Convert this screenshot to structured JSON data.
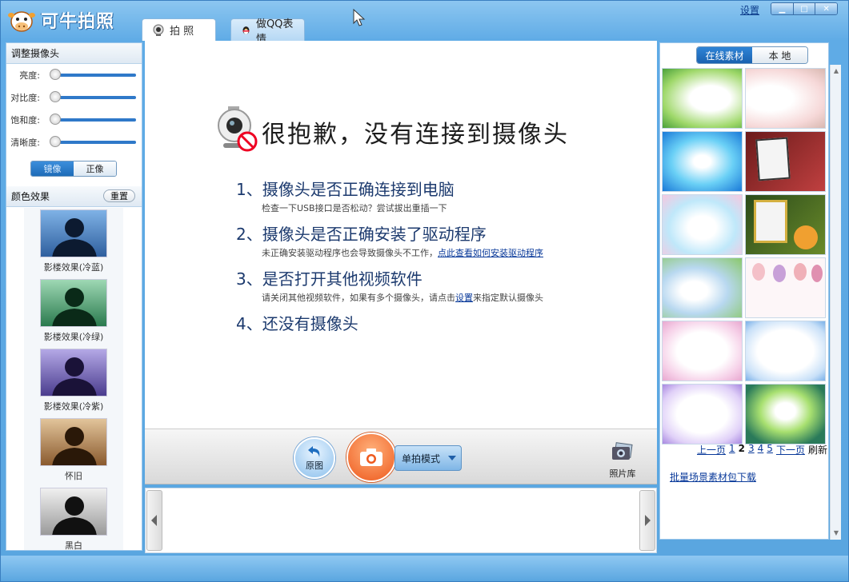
{
  "app": {
    "title": "可牛拍照",
    "settings_link": "设置"
  },
  "window_controls": {
    "minimize": "▁",
    "maximize": "□",
    "close": "✕"
  },
  "tabs": [
    {
      "label": "拍 照",
      "icon": "webcam-icon"
    },
    {
      "label": "做QQ表情",
      "icon": "qq-penguin-icon"
    }
  ],
  "left_panel": {
    "camera_section_title": "调整摄像头",
    "sliders": [
      {
        "label": "亮度:",
        "value": 0
      },
      {
        "label": "对比度:",
        "value": 0
      },
      {
        "label": "饱和度:",
        "value": 0
      },
      {
        "label": "清晰度:",
        "value": 0
      }
    ],
    "mirror_options": [
      "镜像",
      "正像"
    ],
    "mirror_selected": "镜像",
    "effects_section_title": "颜色效果",
    "reset_label": "重置",
    "effects": [
      {
        "label": "影楼效果(冷蓝)",
        "color": "#4a7fc0"
      },
      {
        "label": "影楼效果(冷绿)",
        "color": "#3c9a68"
      },
      {
        "label": "影楼效果(冷紫)",
        "color": "#6a5aa8"
      },
      {
        "label": "怀旧",
        "color": "#a87a4a"
      },
      {
        "label": "黑白",
        "color": "#8a8a8a"
      }
    ]
  },
  "center": {
    "headline": "很抱歉，没有连接到摄像头",
    "items": [
      {
        "title": "1、摄像头是否正确连接到电脑",
        "sub": "检查一下USB接口是否松动？尝试拔出重插一下",
        "link": "",
        "sub_after": ""
      },
      {
        "title": "2、摄像头是否正确安装了驱动程序",
        "sub": "未正确安装驱动程序也会导致摄像头不工作，",
        "link": "点此查看如何安装驱动程序",
        "sub_after": ""
      },
      {
        "title": "3、是否打开其他视频软件",
        "sub": "请关闭其他视频软件，如果有多个摄像头，请点击",
        "link": "设置",
        "sub_after": "来指定默认摄像头"
      },
      {
        "title": "4、还没有摄像头",
        "sub": "",
        "link": "",
        "sub_after": ""
      }
    ]
  },
  "toolbar": {
    "original_label": "原图",
    "mode_label": "单拍模式",
    "gallery_label": "照片库"
  },
  "right_panel": {
    "source_options": [
      "在线素材",
      "本 地"
    ],
    "source_selected": "在线素材",
    "pager": {
      "prev": "上一页",
      "pages": [
        "1",
        "2",
        "3",
        "4",
        "5"
      ],
      "current": "2",
      "next": "下一页",
      "refresh": "刷新"
    },
    "bulk_download_link": "批量场景素材包下载"
  },
  "colors": {
    "accent": "#2f79c9",
    "shoot": "#ee5a1e",
    "frame": "#5aa6e0"
  }
}
